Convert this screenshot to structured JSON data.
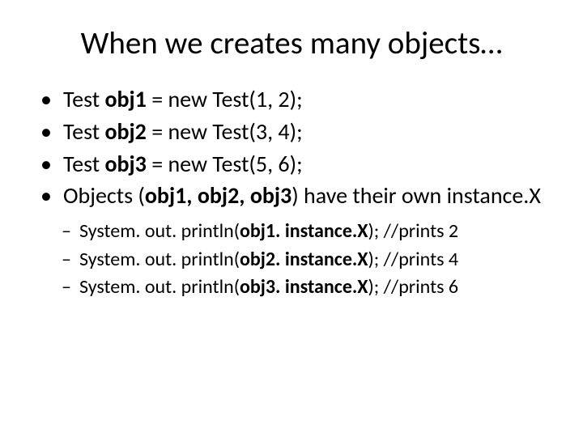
{
  "title": "When we creates many objects…",
  "bullets": [
    {
      "pre": "Test ",
      "bold": "obj1",
      "post": " = new Test(1, 2);"
    },
    {
      "pre": "Test ",
      "bold": "obj2",
      "post": " = new Test(3, 4);"
    },
    {
      "pre": "Test ",
      "bold": "obj3",
      "post": " = new Test(5, 6);"
    },
    {
      "pre": "Objects (",
      "bold": "obj1, obj2, obj3",
      "post": ") have their own instance.X"
    }
  ],
  "subbullets": [
    {
      "pre": "System. out. println(",
      "bold": "obj1. instance.X",
      "post": "); //prints 2"
    },
    {
      "pre": "System. out. println(",
      "bold": "obj2. instance.X",
      "post": "); //prints 4"
    },
    {
      "pre": "System. out. println(",
      "bold": "obj3. instance.X",
      "post": "); //prints 6"
    }
  ]
}
